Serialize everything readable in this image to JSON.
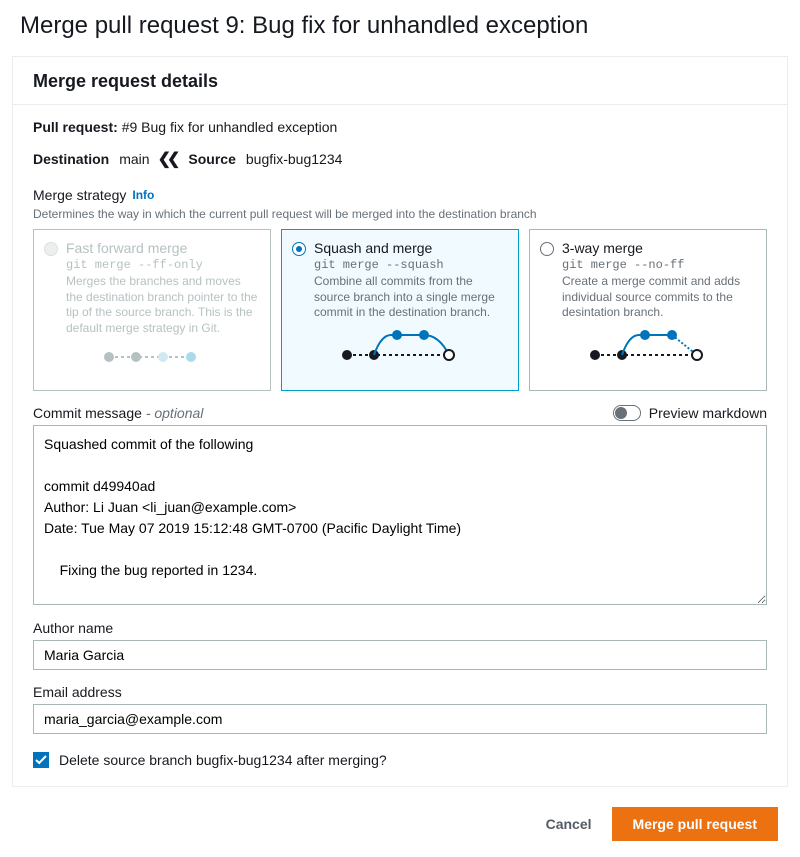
{
  "page_title": "Merge pull request 9: Bug fix for unhandled exception",
  "panel": {
    "header": "Merge request details",
    "pr_label": "Pull request:",
    "pr_id": "#9",
    "pr_title": "Bug fix for unhandled exception",
    "destination_label": "Destination",
    "destination_branch": "main",
    "source_label": "Source",
    "source_branch": "bugfix-bug1234",
    "strategy_label": "Merge strategy",
    "strategy_info": "Info",
    "strategy_help": "Determines the way in which the current pull request will be merged into the destination branch",
    "strategies": [
      {
        "id": "ff",
        "title": "Fast forward merge",
        "cmd": "git merge --ff-only",
        "desc": "Merges the branches and moves the destination branch pointer to the tip of the source branch. This is the default merge strategy in Git.",
        "selected": false,
        "disabled": true
      },
      {
        "id": "squash",
        "title": "Squash and merge",
        "cmd": "git merge --squash",
        "desc": "Combine all commits from the source branch into a single merge commit in the destination branch.",
        "selected": true,
        "disabled": false
      },
      {
        "id": "threeway",
        "title": "3-way merge",
        "cmd": "git merge --no-ff",
        "desc": "Create a merge commit and adds individual source commits to the desintation branch.",
        "selected": false,
        "disabled": false
      }
    ],
    "commit_label": "Commit message",
    "commit_optional": "- optional",
    "preview_label": "Preview markdown",
    "commit_message": "Squashed commit of the following\n\ncommit d49940ad\nAuthor: Li Juan <li_juan@example.com>\nDate: Tue May 07 2019 15:12:48 GMT-0700 (Pacific Daylight Time)\n\n    Fixing the bug reported in 1234.",
    "author_label": "Author name",
    "author_value": "Maria Garcia",
    "email_label": "Email address",
    "email_value": "maria_garcia@example.com",
    "delete_branch_label": "Delete source branch bugfix-bug1234 after merging?",
    "delete_branch_checked": true
  },
  "footer": {
    "cancel": "Cancel",
    "merge": "Merge pull request"
  }
}
